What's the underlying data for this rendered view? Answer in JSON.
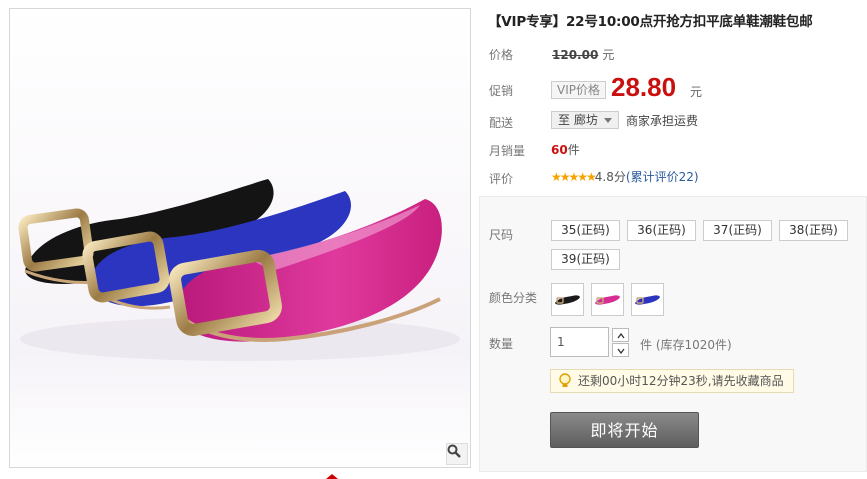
{
  "title": "【VIP专享】22号10:00点开抢方扣平底单鞋潮鞋包邮",
  "price": {
    "label": "价格",
    "original": "120.00",
    "unit": "元"
  },
  "promo": {
    "label": "促销",
    "tag": "VIP价格",
    "value": "28.80",
    "unit": "元"
  },
  "shipping": {
    "label": "配送",
    "location": "至 廊坊",
    "note": "商家承担运费"
  },
  "monthly_sales": {
    "label": "月销量",
    "count": "60",
    "unit": "件"
  },
  "review": {
    "label": "评价",
    "stars": "★★★★★",
    "score": "4.8分",
    "link": "(累计评价22)",
    "rating_value": 4.8
  },
  "options": {
    "size_label": "尺码",
    "sizes": [
      "35(正码)",
      "36(正码)",
      "37(正码)",
      "38(正码)",
      "39(正码)"
    ],
    "color_label": "颜色分类",
    "colors": [
      "black",
      "rose",
      "blue"
    ],
    "qty_label": "数量",
    "qty_value": "1",
    "stock_text": "件 (库存1020件)"
  },
  "notice": "还剩00小时12分钟23秒,请先收藏商品",
  "start_button": "即将开始",
  "icons": {
    "zoom": "magnifier-icon",
    "bulb": "lightbulb-icon"
  },
  "colors_hex": {
    "accent": "#c9100f",
    "link": "#2a5a9e",
    "star": "#f5a300",
    "shoe_black": "#1a1a1a",
    "shoe_blue": "#2b35c0",
    "shoe_pink": "#d62d94"
  }
}
